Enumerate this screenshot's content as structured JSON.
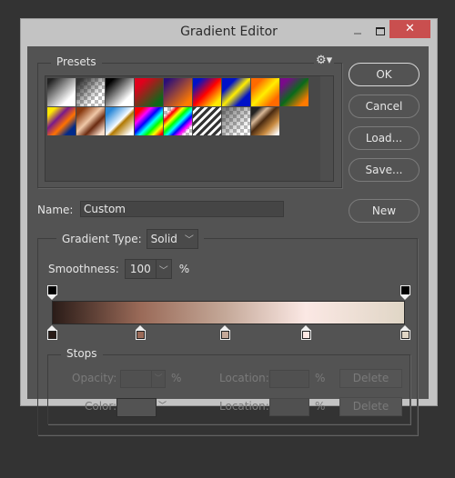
{
  "window": {
    "title": "Gradient Editor",
    "controls": {
      "minimize": "—",
      "maximize": "□",
      "close": "✕"
    }
  },
  "presets": {
    "label": "Presets",
    "menu_icon": "⚙▾",
    "swatches": [
      {
        "name": "foreground-to-background",
        "css": "linear-gradient(135deg,#222 10%,#fff 75%)"
      },
      {
        "name": "foreground-to-transparent",
        "css": "linear-gradient(135deg,#333 10%,rgba(51,51,51,0) 70%),repeating-conic-gradient(#bbb 0 25%,#fff 0 50%) 0 0/8px 8px"
      },
      {
        "name": "black-white",
        "css": "linear-gradient(135deg,#000 15%,#fff 75%)"
      },
      {
        "name": "red-green",
        "css": "linear-gradient(135deg,#e0001c 20%,#0a6a1a 85%)"
      },
      {
        "name": "violet-orange",
        "css": "linear-gradient(135deg,#2a0e7a 10%,#ff7a00 85%)"
      },
      {
        "name": "blue-red-yellow",
        "css": "linear-gradient(135deg,#0012c8 15%,#ff0000 50%,#ffea00 85%)"
      },
      {
        "name": "blue-yellow-blue",
        "css": "linear-gradient(135deg,#0012c8 25%,#ffee00 50%,#0012c8 75%)"
      },
      {
        "name": "orange-yellow-orange",
        "css": "linear-gradient(135deg,#ff6a00 20%,#ffee00 50%,#ff6a00 80%)"
      },
      {
        "name": "violet-green-orange",
        "css": "linear-gradient(135deg,#7a0a8a 15%,#0a6a1a 50%,#ff7a00 85%)"
      },
      {
        "name": "yellow-violet-orange-blue",
        "css": "linear-gradient(135deg,#ffe800 15%,#7a1a8a 38%,#ff7200 60%,#002a8a 82%)"
      },
      {
        "name": "copper",
        "css": "linear-gradient(135deg,#8a3a10 15%,#f0c8a8 45%,#6a2a10 65%,#f8dcc8 90%)"
      },
      {
        "name": "chrome",
        "css": "linear-gradient(135deg,#2a88d8 15%,#e8f4ff 48%,#fff 50%,#b07800 58%,#fff 90%)"
      },
      {
        "name": "spectrum",
        "css": "linear-gradient(135deg,#ff0000 15%,#ff00ff 30%,#0000ff 45%,#00ffff 58%,#00ff00 70%,#ffff00 82%,#ff0000 95%)"
      },
      {
        "name": "transparent-rainbow",
        "css": "linear-gradient(135deg,rgba(255,255,255,0) 15%,#ff0000 25%,#ffff00 35%,#00ff00 45%,#00ffff 55%,#0000ff 65%,#ff00ff 75%,rgba(255,255,255,0) 85%),repeating-conic-gradient(#bbb 0 25%,#fff 0 50%) 0 0/8px 8px"
      },
      {
        "name": "transparent-stripes",
        "css": "repeating-linear-gradient(135deg,#333 0 3px,#fff 3px 6px)"
      },
      {
        "name": "neutral-density",
        "css": "linear-gradient(135deg,rgba(60,60,60,0.7) 5%,rgba(120,120,120,0) 80%),repeating-conic-gradient(#bbb 0 25%,#fff 0 50%) 0 0/8px 8px"
      },
      {
        "name": "brown-custom",
        "css": "linear-gradient(135deg,#222 15%,#d8b898 30%,#4a2a10 45%,#c88a40 70%,#fff 95%)"
      }
    ]
  },
  "buttons": {
    "ok": "OK",
    "cancel": "Cancel",
    "load": "Load...",
    "save": "Save...",
    "new": "New"
  },
  "name_field": {
    "label": "Name:",
    "value": "Custom"
  },
  "gradient_type": {
    "label": "Gradient Type:",
    "value": "Solid"
  },
  "smoothness": {
    "label": "Smoothness:",
    "value": "100",
    "unit": "%"
  },
  "gradient": {
    "opacity_stops": [
      {
        "location_pct": 0,
        "color": "#000000"
      },
      {
        "location_pct": 100,
        "color": "#000000"
      }
    ],
    "color_stops": [
      {
        "location_pct": 0,
        "color": "#2a1c18"
      },
      {
        "location_pct": 25,
        "color": "#9a6a58"
      },
      {
        "location_pct": 49,
        "color": "#c4a898"
      },
      {
        "location_pct": 72,
        "color": "#fbe8e4"
      },
      {
        "location_pct": 100,
        "color": "#e0d6c6"
      }
    ]
  },
  "stops": {
    "label": "Stops",
    "opacity_label": "Opacity:",
    "opacity_unit": "%",
    "opacity_location_label": "Location:",
    "opacity_location_unit": "%",
    "opacity_delete": "Delete",
    "color_label": "Color:",
    "color_location_label": "Location:",
    "color_location_unit": "%",
    "color_delete": "Delete"
  }
}
